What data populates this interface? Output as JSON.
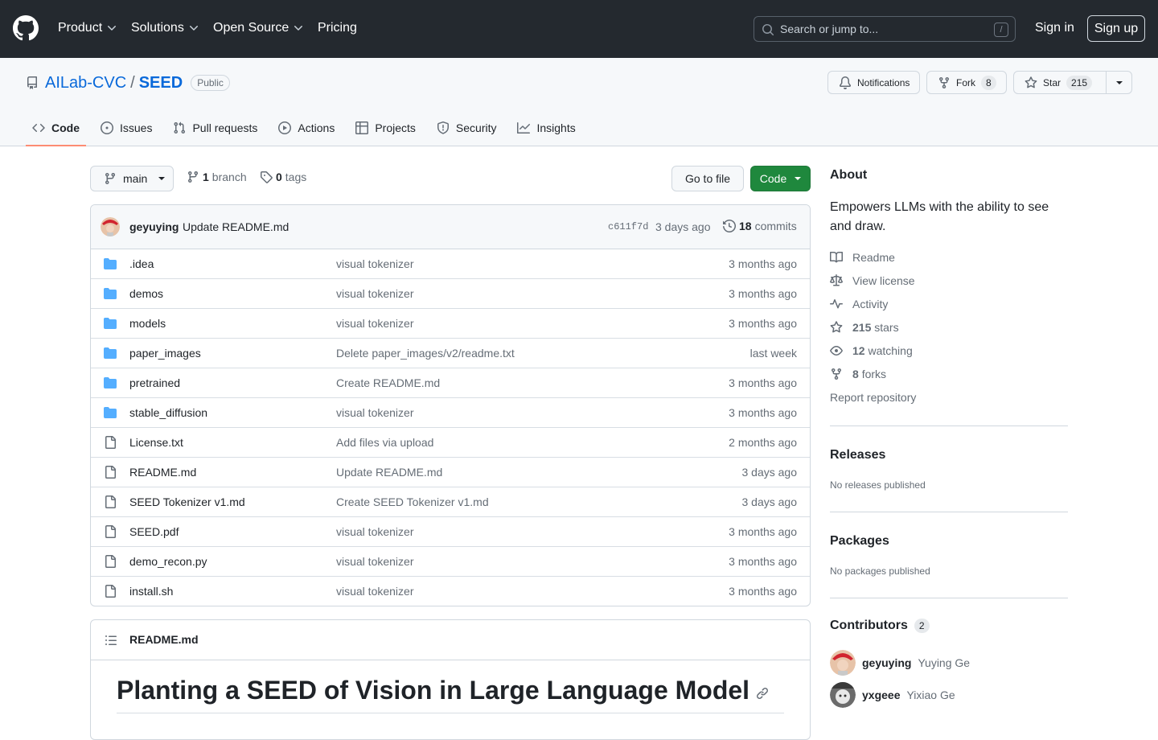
{
  "header": {
    "nav": [
      "Product",
      "Solutions",
      "Open Source",
      "Pricing"
    ],
    "search_placeholder": "Search or jump to...",
    "search_shortcut": "/",
    "sign_in": "Sign in",
    "sign_up": "Sign up"
  },
  "repo": {
    "owner": "AILab-CVC",
    "separator": "/",
    "name": "SEED",
    "visibility": "Public",
    "notifications_label": "Notifications",
    "fork_label": "Fork",
    "fork_count": "8",
    "star_label": "Star",
    "star_count": "215"
  },
  "tabs": [
    "Code",
    "Issues",
    "Pull requests",
    "Actions",
    "Projects",
    "Security",
    "Insights"
  ],
  "branch_bar": {
    "branch": "main",
    "branch_count": "1",
    "branch_word": "branch",
    "tag_count": "0",
    "tag_word": "tags",
    "go_to_file": "Go to file",
    "code_button": "Code"
  },
  "latest_commit": {
    "author": "geyuying",
    "message": "Update README.md",
    "sha": "c611f7d",
    "age": "3 days ago",
    "commit_count": "18",
    "commit_word": "commits"
  },
  "files": [
    {
      "type": "dir",
      "name": ".idea",
      "message": "visual tokenizer",
      "age": "3 months ago"
    },
    {
      "type": "dir",
      "name": "demos",
      "message": "visual tokenizer",
      "age": "3 months ago"
    },
    {
      "type": "dir",
      "name": "models",
      "message": "visual tokenizer",
      "age": "3 months ago"
    },
    {
      "type": "dir",
      "name": "paper_images",
      "message": "Delete paper_images/v2/readme.txt",
      "age": "last week"
    },
    {
      "type": "dir",
      "name": "pretrained",
      "message": "Create README.md",
      "age": "3 months ago"
    },
    {
      "type": "dir",
      "name": "stable_diffusion",
      "message": "visual tokenizer",
      "age": "3 months ago"
    },
    {
      "type": "file",
      "name": "License.txt",
      "message": "Add files via upload",
      "age": "2 months ago"
    },
    {
      "type": "file",
      "name": "README.md",
      "message": "Update README.md",
      "age": "3 days ago"
    },
    {
      "type": "file",
      "name": "SEED Tokenizer v1.md",
      "message": "Create SEED Tokenizer v1.md",
      "age": "3 days ago"
    },
    {
      "type": "file",
      "name": "SEED.pdf",
      "message": "visual tokenizer",
      "age": "3 months ago"
    },
    {
      "type": "file",
      "name": "demo_recon.py",
      "message": "visual tokenizer",
      "age": "3 months ago"
    },
    {
      "type": "file",
      "name": "install.sh",
      "message": "visual tokenizer",
      "age": "3 months ago"
    }
  ],
  "readme": {
    "filename": "README.md",
    "heading": "Planting a SEED of Vision in Large Language Model"
  },
  "sidebar": {
    "about_title": "About",
    "description": "Empowers LLMs with the ability to see and draw.",
    "readme": "Readme",
    "license": "View license",
    "activity": "Activity",
    "stars_count": "215",
    "stars_word": "stars",
    "watching_count": "12",
    "watching_word": "watching",
    "forks_count": "8",
    "forks_word": "forks",
    "report": "Report repository",
    "releases_title": "Releases",
    "releases_empty": "No releases published",
    "packages_title": "Packages",
    "packages_empty": "No packages published",
    "contributors_title": "Contributors",
    "contributors_count": "2",
    "contributors": [
      {
        "login": "geyuying",
        "name": "Yuying Ge"
      },
      {
        "login": "yxgeee",
        "name": "Yixiao Ge"
      }
    ]
  },
  "colors": {
    "header_bg": "#24292f",
    "link": "#0969da",
    "code_button": "#1f883d",
    "active_tab": "#fd8c73",
    "folder": "#54aeff"
  }
}
